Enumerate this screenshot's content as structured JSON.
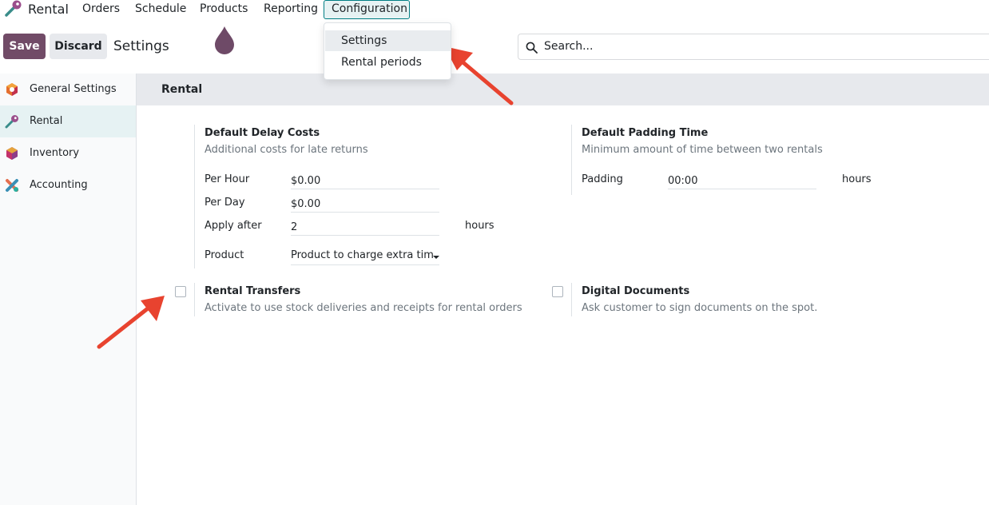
{
  "navbar": {
    "app_name": "Rental",
    "menus": [
      "Orders",
      "Schedule",
      "Products",
      "Reporting"
    ],
    "active_menu": "Configuration"
  },
  "dropdown": {
    "items": [
      "Settings",
      "Rental periods"
    ]
  },
  "control_panel": {
    "save_label": "Save",
    "discard_label": "Discard",
    "title": "Settings",
    "search_placeholder": "Search..."
  },
  "sidebar": {
    "items": [
      {
        "label": "General Settings",
        "icon": "odoo-settings-icon"
      },
      {
        "label": "Rental",
        "icon": "rental-key-icon"
      },
      {
        "label": "Inventory",
        "icon": "inventory-box-icon"
      },
      {
        "label": "Accounting",
        "icon": "accounting-icon"
      }
    ],
    "active": "Rental"
  },
  "section": {
    "title": "Rental"
  },
  "delay_costs": {
    "title": "Default Delay Costs",
    "description": "Additional costs for late returns",
    "per_hour_label": "Per Hour",
    "per_hour_value": "$0.00",
    "per_day_label": "Per Day",
    "per_day_value": "$0.00",
    "apply_after_label": "Apply after",
    "apply_after_value": "2",
    "apply_after_unit": "hours",
    "product_label": "Product",
    "product_value": "Product to charge extra tim"
  },
  "padding_time": {
    "title": "Default Padding Time",
    "description": "Minimum amount of time between two rentals",
    "padding_label": "Padding",
    "padding_value": "00:00",
    "padding_unit": "hours"
  },
  "rental_transfers": {
    "title": "Rental Transfers",
    "description": "Activate to use stock deliveries and receipts for rental orders",
    "checked": false
  },
  "digital_documents": {
    "title": "Digital Documents",
    "description": "Ask customer to sign documents on the spot.",
    "checked": false
  },
  "colors": {
    "primary": "#714b67",
    "accent_teal": "#017e84",
    "annotation_arrow": "#e8432f"
  }
}
